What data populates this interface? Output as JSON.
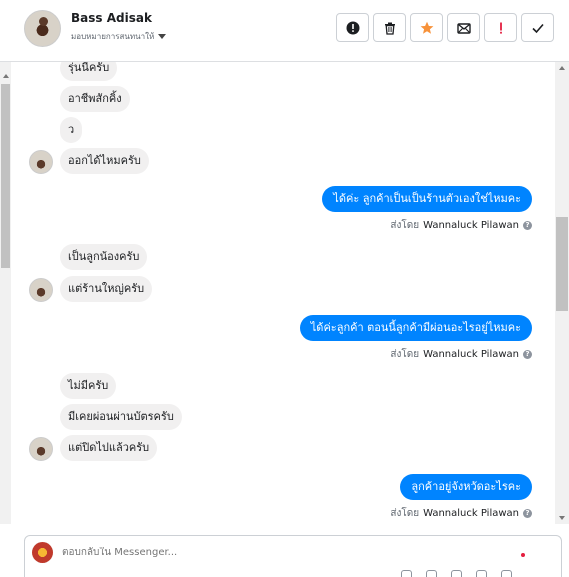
{
  "header": {
    "contact_name": "Bass Adisak",
    "assign_label": "มอบหมายการสนทนาให้",
    "toolbar": [
      {
        "icon": "alert-circle-icon",
        "name": "mark-spam-button"
      },
      {
        "icon": "trash-icon",
        "name": "delete-button"
      },
      {
        "icon": "star-icon",
        "name": "star-button",
        "color": "#f7923a"
      },
      {
        "icon": "mark-unread-icon",
        "name": "mark-unread-button"
      },
      {
        "icon": "exclamation-icon",
        "name": "follow-up-button",
        "color": "#e41e3f"
      },
      {
        "icon": "check-icon",
        "name": "mark-done-button"
      }
    ]
  },
  "messages": {
    "m1": "รุ่นนี้ครับ",
    "m2": "อาชีพสักคิ้ง",
    "m3": "ว",
    "m4": "ออกได้ไหมครับ",
    "m5": "ได้ค่ะ ลูกค้าเป็นเป็นร้านตัวเองใช่ไหมคะ",
    "m6": "เป็นลูกน้องครับ",
    "m7": "แต่ร้านใหญ่ครับ",
    "m8": "ได้ค่ะลูกค้า  ตอนนี้ลูกค้ามีผ่อนอะไรอยู่ไหมคะ",
    "m9": "ไม่มีครับ",
    "m10": "มีเคยผ่อนผ่านบัตรครับ",
    "m11": "แต่ปิดไปแล้วครับ",
    "m12": "ลูกค้าอยู่จังหวัดอะไรคะ"
  },
  "sent_by": {
    "prefix": "ส่งโดย",
    "agent": "Wannaluck Pilawan",
    "help": "?"
  },
  "composer": {
    "placeholder": "ตอบกลับใน Messenger..."
  },
  "colors": {
    "outgoing_bubble": "#0084ff",
    "incoming_bubble": "#f1f0f0"
  }
}
